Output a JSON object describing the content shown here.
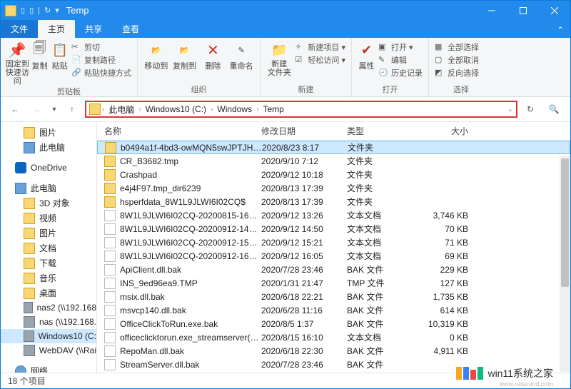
{
  "title": "Temp",
  "qat": {
    "sep": "|"
  },
  "tabs": {
    "file": "文件",
    "home": "主页",
    "share": "共享",
    "view": "查看"
  },
  "ribbon": {
    "pin": "固定到快速访问",
    "copy": "复制",
    "paste": "粘贴",
    "cut": "剪切",
    "copypath": "复制路径",
    "pasteshort": "粘贴快捷方式",
    "clip_label": "剪贴板",
    "moveto": "移动到",
    "copyto": "复制到",
    "delete": "删除",
    "rename": "重命名",
    "org_label": "组织",
    "newfolder": "新建\n文件夹",
    "newitem": "新建项目 ▾",
    "easyaccess": "轻松访问 ▾",
    "new_label": "新建",
    "props": "属性",
    "openmenu": "打开 ▾",
    "edit": "编辑",
    "history": "历史记录",
    "open_label": "打开",
    "selall": "全部选择",
    "selnone": "全部取消",
    "selinv": "反向选择",
    "sel_label": "选择"
  },
  "breadcrumb": [
    "此电脑",
    "Windows10 (C:)",
    "Windows",
    "Temp"
  ],
  "sidebar": [
    {
      "label": "图片",
      "cls": "sub",
      "ico": ""
    },
    {
      "label": "此电脑",
      "cls": "sub",
      "ico": "pc"
    },
    {
      "label": "",
      "cls": "gap",
      "ico": ""
    },
    {
      "label": "OneDrive",
      "cls": "",
      "ico": "od"
    },
    {
      "label": "",
      "cls": "gap",
      "ico": ""
    },
    {
      "label": "此电脑",
      "cls": "",
      "ico": "pc"
    },
    {
      "label": "3D 对象",
      "cls": "sub",
      "ico": ""
    },
    {
      "label": "视频",
      "cls": "sub",
      "ico": ""
    },
    {
      "label": "图片",
      "cls": "sub",
      "ico": ""
    },
    {
      "label": "文档",
      "cls": "sub",
      "ico": ""
    },
    {
      "label": "下载",
      "cls": "sub",
      "ico": ""
    },
    {
      "label": "音乐",
      "cls": "sub",
      "ico": ""
    },
    {
      "label": "桌面",
      "cls": "sub",
      "ico": ""
    },
    {
      "label": "nas2 (\\\\192.168",
      "cls": "sub",
      "ico": "drv"
    },
    {
      "label": "nas (\\\\192.168.",
      "cls": "sub",
      "ico": "drv"
    },
    {
      "label": "Windows10 (C:",
      "cls": "sub sel",
      "ico": "drv"
    },
    {
      "label": "WebDAV (\\\\Rai",
      "cls": "sub",
      "ico": "drv"
    },
    {
      "label": "",
      "cls": "gap",
      "ico": ""
    },
    {
      "label": "网络",
      "cls": "",
      "ico": "net"
    }
  ],
  "columns": {
    "name": "名称",
    "date": "修改日期",
    "type": "类型",
    "size": "大小"
  },
  "files": [
    {
      "name": "b0494a1f-4bd3-owMQN5swJPTJH+i...",
      "date": "2020/8/23 8:17",
      "type": "文件夹",
      "size": "",
      "folder": true,
      "sel": true
    },
    {
      "name": "CR_B3682.tmp",
      "date": "2020/9/10 7:12",
      "type": "文件夹",
      "size": "",
      "folder": true
    },
    {
      "name": "Crashpad",
      "date": "2020/9/12 10:18",
      "type": "文件夹",
      "size": "",
      "folder": true
    },
    {
      "name": "e4j4F97.tmp_dir6239",
      "date": "2020/8/13 17:39",
      "type": "文件夹",
      "size": "",
      "folder": true
    },
    {
      "name": "hsperfdata_8W1L9JLWI6I02CQ$",
      "date": "2020/8/13 17:39",
      "type": "文件夹",
      "size": "",
      "folder": true
    },
    {
      "name": "8W1L9JLWI6I02CQ-20200815-1624.l...",
      "date": "2020/9/12 13:26",
      "type": "文本文档",
      "size": "3,746 KB"
    },
    {
      "name": "8W1L9JLWI6I02CQ-20200912-1450.l...",
      "date": "2020/9/12 14:50",
      "type": "文本文档",
      "size": "70 KB"
    },
    {
      "name": "8W1L9JLWI6I02CQ-20200912-1521.l...",
      "date": "2020/9/12 15:21",
      "type": "文本文档",
      "size": "71 KB"
    },
    {
      "name": "8W1L9JLWI6I02CQ-20200912-1605.l...",
      "date": "2020/9/12 16:05",
      "type": "文本文档",
      "size": "69 KB"
    },
    {
      "name": "ApiClient.dll.bak",
      "date": "2020/7/28 23:46",
      "type": "BAK 文件",
      "size": "229 KB"
    },
    {
      "name": "INS_9ed96ea9.TMP",
      "date": "2020/1/31 21:47",
      "type": "TMP 文件",
      "size": "127 KB"
    },
    {
      "name": "msix.dll.bak",
      "date": "2020/6/18 22:21",
      "type": "BAK 文件",
      "size": "1,735 KB"
    },
    {
      "name": "msvcp140.dll.bak",
      "date": "2020/6/28 11:16",
      "type": "BAK 文件",
      "size": "614 KB"
    },
    {
      "name": "OfficeClickToRun.exe.bak",
      "date": "2020/8/5 1:37",
      "type": "BAK 文件",
      "size": "10,319 KB"
    },
    {
      "name": "officeclicktorun.exe_streamserver(20...",
      "date": "2020/8/15 16:10",
      "type": "文本文档",
      "size": "0 KB"
    },
    {
      "name": "RepoMan.dll.bak",
      "date": "2020/6/18 22:30",
      "type": "BAK 文件",
      "size": "4,911 KB"
    },
    {
      "name": "StreamServer.dll.bak",
      "date": "2020/7/28 23:46",
      "type": "BAK 文件",
      "size": ""
    }
  ],
  "status": "18 个项目",
  "watermark": {
    "text": "win11系统之家",
    "footer": "www.relsound.com"
  }
}
